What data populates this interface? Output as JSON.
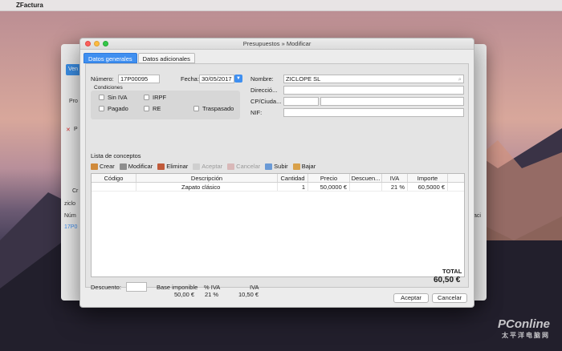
{
  "menubar": {
    "apple": "",
    "app_name": "ZFactura"
  },
  "background_window": {
    "tab": "Ven",
    "labels": [
      "Pro",
      "Cr",
      "ziclo",
      "Núm",
      "17P0"
    ],
    "close_mark": "P",
    "right_mark": "aci"
  },
  "dialog": {
    "title": "Presupuestos » Modificar",
    "tabs": [
      "Datos generales",
      "Datos adicionales"
    ],
    "numero_label": "Número:",
    "numero_value": "17P00095",
    "fecha_label": "Fecha:",
    "fecha_value": "30/05/2017",
    "condiciones_label": "Condiciones",
    "conditions": {
      "sin_iva": "Sin IVA",
      "irpf": "IRPF",
      "pagado": "Pagado",
      "re": "RE",
      "traspasado": "Traspasado"
    },
    "nombre_label": "Nombre:",
    "nombre_value": "ZICLOPE SL",
    "direccion_label": "Direcció...",
    "cp_label": "CP/Ciuda...",
    "nif_label": "NIF:",
    "lista_label": "Lista de conceptos",
    "toolbar": {
      "crear": "Crear",
      "modificar": "Modificar",
      "eliminar": "Eliminar",
      "aceptar": "Aceptar",
      "cancelar": "Cancelar",
      "subir": "Subir",
      "bajar": "Bajar"
    },
    "table": {
      "headers": [
        "Código",
        "Descripción",
        "Cantidad",
        "Precio",
        "Descuen...",
        "IVA",
        "Importe"
      ],
      "rows": [
        {
          "codigo": "",
          "descripcion": "Zapato clásico",
          "cantidad": "1",
          "precio": "50,0000 €",
          "descuento": "",
          "iva": "21 %",
          "importe": "60,5000 €"
        }
      ]
    },
    "footer": {
      "descuento_label": "Descuento:",
      "descuento_value": "",
      "base_label": "Base imponible",
      "base_value": "50,00 €",
      "piva_label": "% IVA",
      "piva_value": "21 %",
      "iva_label": "IVA",
      "iva_value": "10,50 €",
      "total_label": "TOTAL",
      "total_value": "60,50 €"
    },
    "buttons": {
      "aceptar": "Aceptar",
      "cancelar": "Cancelar"
    }
  },
  "watermark": {
    "brand": "PConline",
    "sub": "太平洋电脑网"
  },
  "colors": {
    "accent": "#3f8ff0",
    "traffic_close": "#fc605c",
    "traffic_min": "#fdbc40",
    "traffic_max": "#34c84a"
  }
}
